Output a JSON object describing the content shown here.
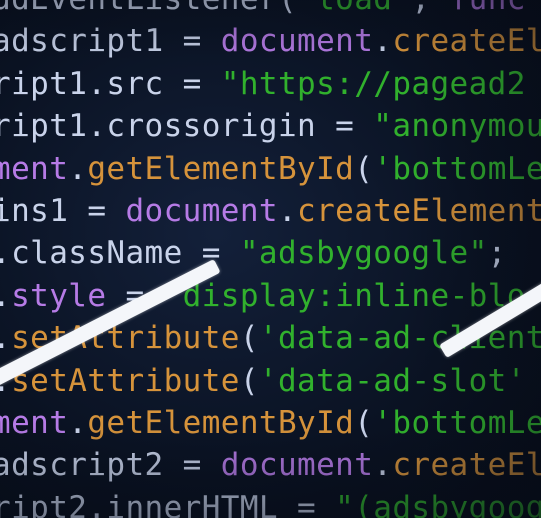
{
  "code_lines": [
    [
      [
        "t-plain",
        "udEventListener("
      ],
      [
        "t-str",
        "'load'"
      ],
      [
        "t-plain",
        ", "
      ],
      [
        "t-kw",
        "func"
      ]
    ],
    [
      [
        "t-plain",
        "adscript1 = "
      ],
      [
        "t-kw",
        "document"
      ],
      [
        "t-plain",
        "."
      ],
      [
        "t-fn",
        "createEl"
      ]
    ],
    [
      [
        "t-plain",
        "ript1.src = "
      ],
      [
        "t-str",
        "\"https://pagead2"
      ]
    ],
    [
      [
        "t-plain",
        "ript1.crossorigin = "
      ],
      [
        "t-str",
        "\"anonymou"
      ]
    ],
    [
      [
        "t-kw",
        "ment"
      ],
      [
        "t-plain",
        "."
      ],
      [
        "t-fn",
        "getElementById"
      ],
      [
        "t-plain",
        "("
      ],
      [
        "t-str",
        "'bottomLe"
      ]
    ],
    [
      [
        "t-plain",
        "ins1 = "
      ],
      [
        "t-kw",
        "document"
      ],
      [
        "t-plain",
        "."
      ],
      [
        "t-fn",
        "createElement"
      ]
    ],
    [
      [
        "t-plain",
        ".className = "
      ],
      [
        "t-str",
        "\"adsbygoogle\""
      ],
      [
        "t-plain",
        ";"
      ]
    ],
    [
      [
        "t-plain",
        "."
      ],
      [
        "t-kw",
        "style"
      ],
      [
        "t-plain",
        " = "
      ],
      [
        "t-str",
        "\"display:inline-blo"
      ]
    ],
    [
      [
        "t-plain",
        "."
      ],
      [
        "t-fn",
        "setAttribute"
      ],
      [
        "t-plain",
        "("
      ],
      [
        "t-str",
        "'data-ad-client"
      ]
    ],
    [
      [
        "t-plain",
        "."
      ],
      [
        "t-fn",
        "setAttribute"
      ],
      [
        "t-plain",
        "("
      ],
      [
        "t-str",
        "'data-ad-slot'"
      ]
    ],
    [
      [
        "t-kw",
        "ment"
      ],
      [
        "t-plain",
        "."
      ],
      [
        "t-fn",
        "getElementById"
      ],
      [
        "t-plain",
        "("
      ],
      [
        "t-str",
        "'bottomLe"
      ]
    ],
    [
      [
        "t-plain",
        "adscript2 = "
      ],
      [
        "t-kw",
        "document"
      ],
      [
        "t-plain",
        "."
      ],
      [
        "t-fn",
        "createEl"
      ]
    ],
    [
      [
        "t-plain",
        "ript2.innerHTML = "
      ],
      [
        "t-str",
        "\"(adsbygoog"
      ]
    ]
  ]
}
